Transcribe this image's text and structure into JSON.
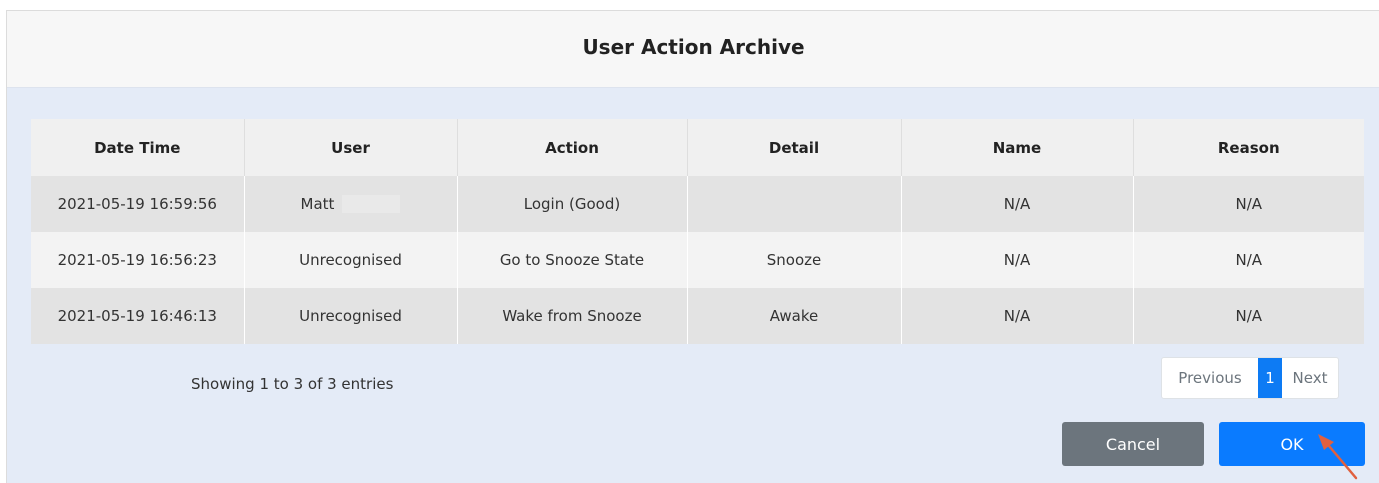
{
  "dialog": {
    "title": "User Action Archive"
  },
  "table": {
    "headers": [
      "Date Time",
      "User",
      "Action",
      "Detail",
      "Name",
      "Reason"
    ],
    "rows": [
      [
        "2021-05-19 16:59:56",
        "Matt",
        "Login (Good)",
        "",
        "N/A",
        "N/A"
      ],
      [
        "2021-05-19 16:56:23",
        "Unrecognised",
        "Go to Snooze State",
        "Snooze",
        "N/A",
        "N/A"
      ],
      [
        "2021-05-19 16:46:13",
        "Unrecognised",
        "Wake from Snooze",
        "Awake",
        "N/A",
        "N/A"
      ]
    ]
  },
  "footer": {
    "info": "Showing 1 to 3 of 3 entries",
    "pagination": {
      "previous": "Previous",
      "current": "1",
      "next": "Next"
    }
  },
  "buttons": {
    "cancel": "Cancel",
    "ok": "OK"
  },
  "colors": {
    "primary": "#0a7bff",
    "secondary": "#6c757d",
    "dialog_bg": "#e4ebf7",
    "pointer_arrow": "#e0603f"
  },
  "icons": {
    "pointer": "arrow-pointer-icon"
  }
}
